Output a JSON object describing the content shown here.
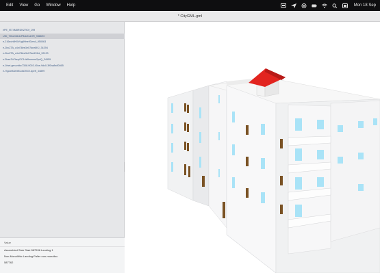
{
  "menubar": {
    "items": [
      "Edit",
      "View",
      "Go",
      "Window",
      "Help"
    ],
    "clock": "Mon 18 Sep",
    "status_icons": [
      "display-icon",
      "send-icon",
      "record-icon",
      "battery-icon",
      "wifi-icon",
      "search-icon",
      "control-center-icon"
    ]
  },
  "window": {
    "title": "* CityGML.gml"
  },
  "tree": {
    "items": [
      "ePE_IST4M8RDNZ7tDf_199",
      "UID_7IDoD6b4vP8nk9vdOR_988693",
      "e-216ech0KKbVg8Hne93vm4_950063",
      "e-2bcZTA_c4ni78ee3e07dez8KJ_34294",
      "e-2bcZTA_c4ni78ee3e07de6SKd_32123",
      "e-3ban7bFhepOC1oWhsmsm2psQ_34959",
      "e-1fnei-gen-ebbc7308-9003-40ce-9dc0-3f0ba8e80465",
      "e-7tgoie83ebf6Lds0937Lkpeft_34899"
    ],
    "selected_index": 1
  },
  "properties": {
    "header": "Value",
    "lines": [
      "Assembled Stair Stair:587536 Landing 1",
      "Non-Monolithic Landing:Paller non-monolisc",
      "587762"
    ]
  },
  "colors": {
    "roof": "#e2241f",
    "window_glass": "#a9e3f7",
    "door": "#7a5224",
    "wall": "#f4f4f4"
  }
}
